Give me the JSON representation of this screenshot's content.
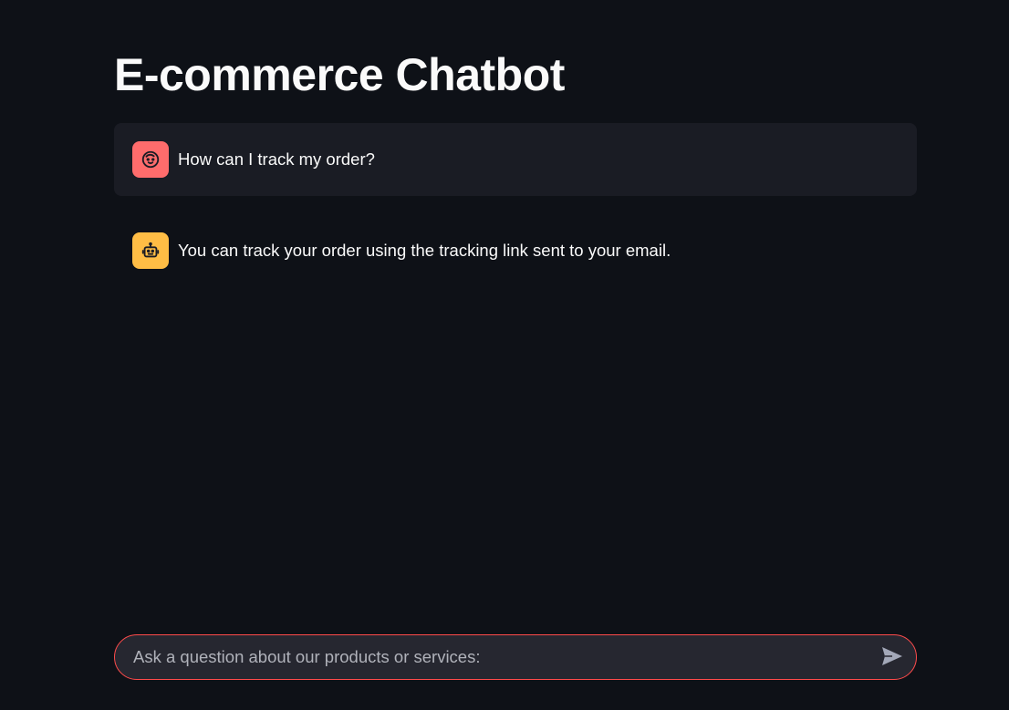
{
  "page": {
    "title": "E-commerce Chatbot"
  },
  "messages": [
    {
      "role": "user",
      "avatar_icon": "user-face-icon",
      "avatar_color": "#ff6c6c",
      "text": "How can I track my order?"
    },
    {
      "role": "assistant",
      "avatar_icon": "robot-icon",
      "avatar_color": "#ffbd45",
      "text": "You can track your order using the tracking link sent to your email."
    }
  ],
  "chat_input": {
    "placeholder": "Ask a question about our products or services:",
    "value": "",
    "send_icon": "send-icon",
    "border_color": "#ff4b4b"
  },
  "theme": {
    "background": "#0e1117",
    "user_bubble": "#1a1c24",
    "input_background": "#262730",
    "text": "#fafafa"
  }
}
